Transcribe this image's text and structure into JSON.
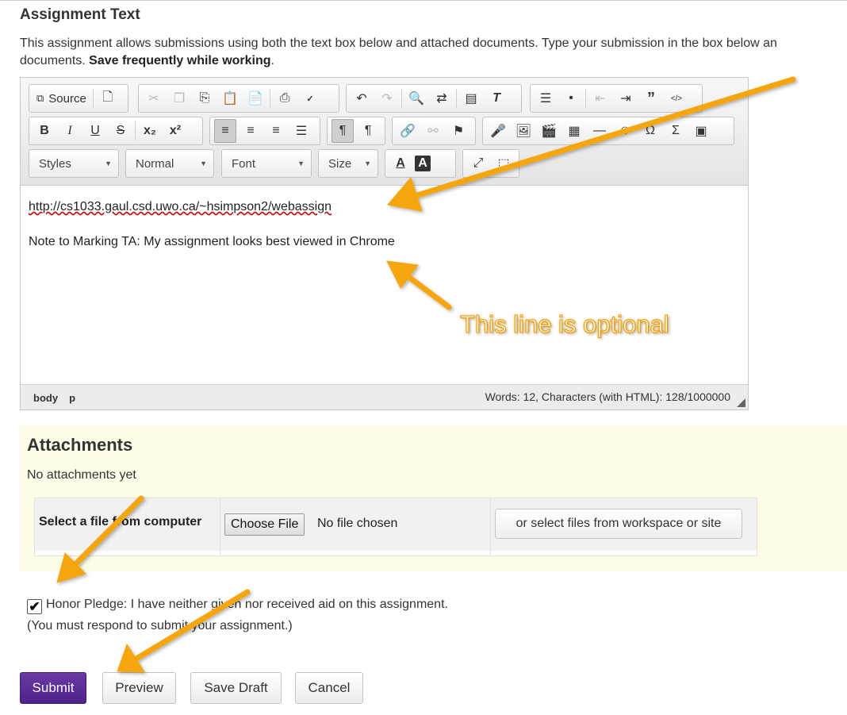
{
  "title": "Assignment Text",
  "instructions": {
    "text": "This assignment allows submissions using both the text box below and attached documents. Type your submission in the box below an",
    "text2": "documents. ",
    "bold": "Save frequently while working",
    "end": "."
  },
  "toolbar": {
    "source_label": "Source",
    "styles_label": "Styles",
    "format_label": "Normal",
    "font_label": "Font",
    "size_label": "Size"
  },
  "editor": {
    "line1": "http://cs1033.gaul.csd.uwo.ca/~hsimpson2/webassign",
    "line2": "Note to Marking TA: My assignment looks best viewed in Chrome",
    "path": [
      "body",
      "p"
    ],
    "word_count": "Words: 12, Characters (with HTML): 128/1000000"
  },
  "attachments": {
    "heading": "Attachments",
    "none": "No attachments yet",
    "select_label": "Select a file from computer",
    "choose_button": "Choose File",
    "no_file": "No file chosen",
    "workspace_button": "or select files from workspace or site"
  },
  "pledge": {
    "checked": true,
    "text": "Honor Pledge: I have neither given nor received aid on this assignment.",
    "note": "(You must respond to submit your assignment.)"
  },
  "buttons": {
    "submit": "Submit",
    "preview": "Preview",
    "save_draft": "Save Draft",
    "cancel": "Cancel"
  },
  "annotation": {
    "optional_text": "This line is optional",
    "arrow_color": "#f5a50a"
  },
  "colors": {
    "submit_bg": "#5a2a94",
    "attachments_bg": "#fefee8"
  }
}
